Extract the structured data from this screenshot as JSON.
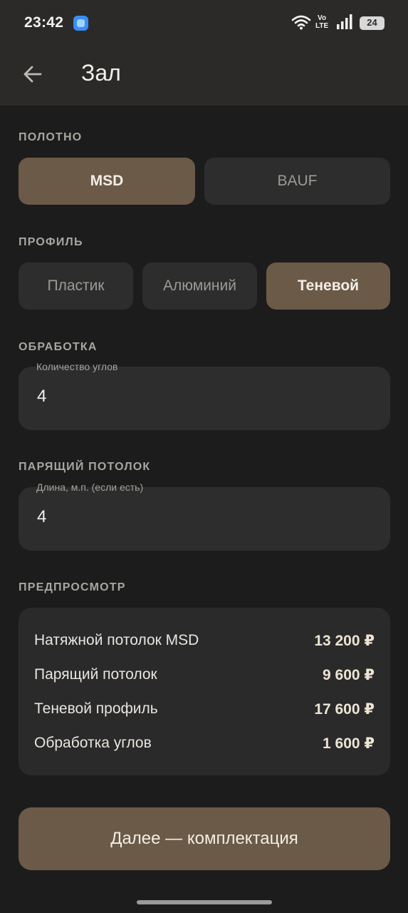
{
  "status_bar": {
    "time": "23:42",
    "network": "Vo\nLTE",
    "battery": "24",
    "icons": [
      "app-notification-icon",
      "wifi-icon",
      "signal-icon",
      "battery-icon"
    ]
  },
  "app_bar": {
    "back_icon": "arrow-left-icon",
    "title": "Зал"
  },
  "canvas": {
    "label": "ПОЛОТНО",
    "options": [
      "MSD",
      "BAUF"
    ],
    "selected": "MSD"
  },
  "profile": {
    "label": "ПРОФИЛЬ",
    "options": [
      "Пластик",
      "Алюминий",
      "Теневой"
    ],
    "selected": "Теневой"
  },
  "processing": {
    "label": "ОБРАБОТКА",
    "field_label": "Количество углов",
    "value": "4"
  },
  "floating": {
    "label": "ПАРЯЩИЙ ПОТОЛОК",
    "field_label": "Длина, м.п. (если есть)",
    "value": "4"
  },
  "preview": {
    "label": "ПРЕДПРОСМОТР",
    "rows": [
      {
        "name": "Натяжной потолок MSD",
        "price": "13 200 ₽"
      },
      {
        "name": "Парящий потолок",
        "price": "9 600 ₽"
      },
      {
        "name": "Теневой профиль",
        "price": "17 600 ₽"
      },
      {
        "name": "Обработка углов",
        "price": "1 600 ₽"
      }
    ]
  },
  "next_button": "Далее — комплектация",
  "colors": {
    "background": "#1c1c1c",
    "surface": "#2d2d2d",
    "accent": "#6b5a48",
    "header": "#2b2a28"
  }
}
